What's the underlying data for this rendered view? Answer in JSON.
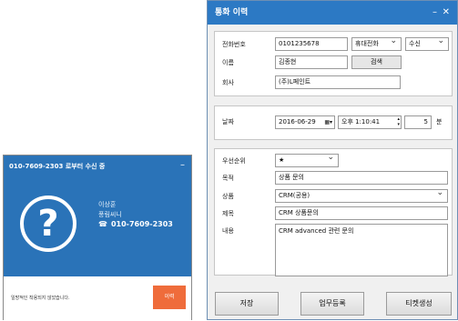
{
  "popup": {
    "title": "010-7609-2303 로부터 수신 중",
    "minimize": "–",
    "question_mark": "?",
    "caller_name": "이상훈",
    "caller_company": "풍림씨니",
    "caller_phone": "010-7609-2303",
    "phone_icon": "☎",
    "message": "일방적인 착용되지 않았습니다.",
    "action_button": "이력"
  },
  "window": {
    "title": "통화 이력",
    "minimize": "–",
    "close": "✕",
    "fields": {
      "phone_label": "전화번호",
      "phone_value": "0101235678",
      "phone_type": "휴대전화",
      "direction": "수신",
      "name_label": "이름",
      "name_value": "김종현",
      "search_button": "검색",
      "company_label": "회사",
      "company_value": "(주)L페인트",
      "date_label": "날짜",
      "date_value": "2016-06-29",
      "time_value": "오후  1:10:41",
      "duration_value": "5",
      "duration_unit": "분",
      "priority_label": "우선순위",
      "priority_value": "★",
      "purpose_label": "목적",
      "purpose_value": "상품 문의",
      "product_label": "상품",
      "product_value": "CRM(공용)",
      "subject_label": "제목",
      "subject_value": "CRM 상품문의",
      "content_label": "내용",
      "content_value": "CRM advanced 관련 문의"
    },
    "buttons": {
      "save": "저장",
      "task_register": "업무등록",
      "ticket_create": "티켓생성"
    }
  }
}
